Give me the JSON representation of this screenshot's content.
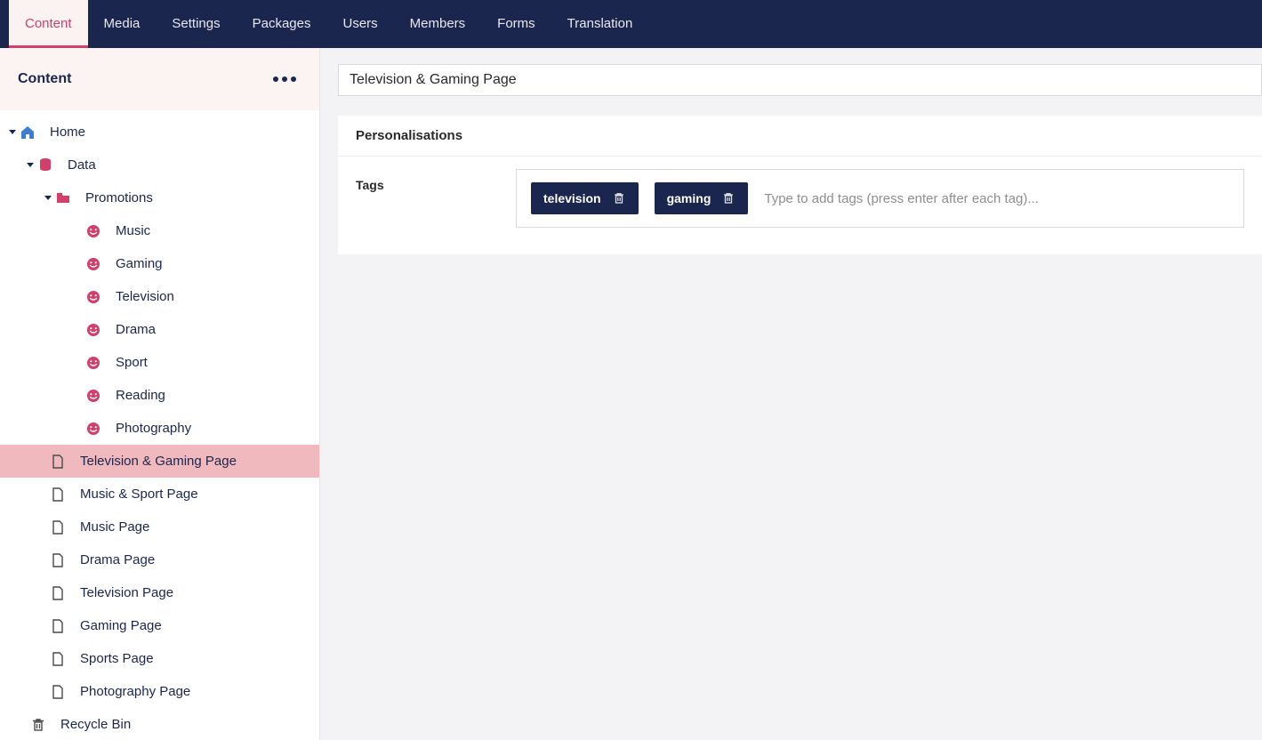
{
  "colors": {
    "accent": "#d13f6a",
    "navy": "#1b264f",
    "blue": "#3d7ed4",
    "rowSelected": "#f0b9bd"
  },
  "topnav": {
    "tabs": [
      {
        "label": "Content",
        "active": true
      },
      {
        "label": "Media"
      },
      {
        "label": "Settings"
      },
      {
        "label": "Packages"
      },
      {
        "label": "Users"
      },
      {
        "label": "Members"
      },
      {
        "label": "Forms"
      },
      {
        "label": "Translation"
      }
    ]
  },
  "sidebar": {
    "title": "Content",
    "tree": {
      "home": "Home",
      "data": "Data",
      "promotions": "Promotions",
      "promo_items": [
        "Music",
        "Gaming",
        "Television",
        "Drama",
        "Sport",
        "Reading",
        "Photography"
      ],
      "pages": [
        "Television & Gaming Page",
        "Music & Sport Page",
        "Music Page",
        "Drama Page",
        "Television Page",
        "Gaming Page",
        "Sports Page",
        "Photography Page"
      ],
      "selected_page": "Television & Gaming Page",
      "recycle": "Recycle Bin"
    }
  },
  "editor": {
    "title_value": "Television & Gaming Page",
    "panel_title": "Personalisations",
    "tags_label": "Tags",
    "tags": [
      "television",
      "gaming"
    ],
    "tags_placeholder": "Type to add tags (press enter after each tag)..."
  }
}
